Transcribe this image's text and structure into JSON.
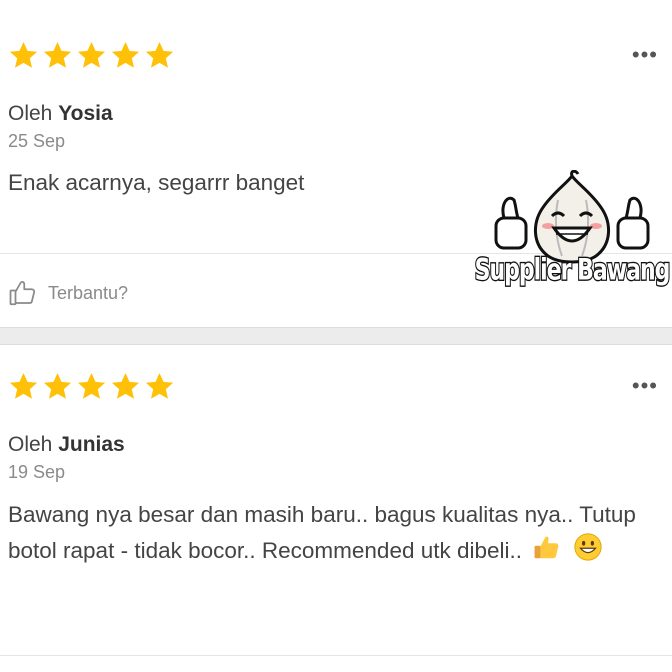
{
  "reviews": [
    {
      "rating": 5,
      "by_prefix": "Oleh",
      "author": "Yosia",
      "date": "25 Sep",
      "text": "Enak acarnya, segarrr banget",
      "helpful_label": "Terbantu?",
      "more_label": "•••"
    },
    {
      "rating": 5,
      "by_prefix": "Oleh",
      "author": "Junias",
      "date": "19 Sep",
      "text": "Bawang nya besar dan masih baru.. bagus kualitas nya.. Tutup botol rapat - tidak bocor.. Recommended utk dibeli..",
      "emojis": [
        "thumbs-up-emoji",
        "grinning-face-emoji"
      ],
      "more_label": "•••"
    }
  ],
  "watermark": {
    "text": "Supplier Bawang"
  },
  "colors": {
    "star": "#FFC107",
    "divider": "#ECECEC",
    "muted": "#8A8A8A"
  }
}
